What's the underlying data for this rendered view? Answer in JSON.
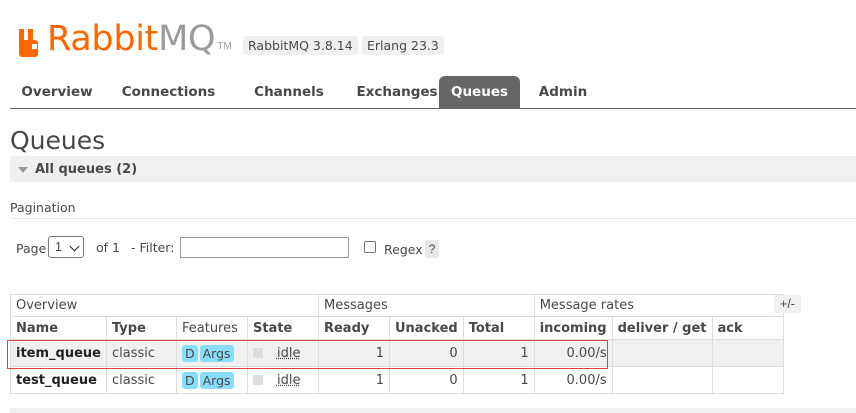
{
  "header": {
    "logo_rabbit": "Rabbit",
    "logo_mq": "MQ",
    "logo_tm": "TM",
    "rabbitmq_version": "RabbitMQ 3.8.14",
    "erlang_version": "Erlang 23.3",
    "brand_color": "#ff6600"
  },
  "nav": {
    "tabs": [
      {
        "label": "Overview"
      },
      {
        "label": "Connections"
      },
      {
        "label": "Channels"
      },
      {
        "label": "Exchanges"
      },
      {
        "label": "Queues",
        "active": true
      },
      {
        "label": "Admin"
      }
    ]
  },
  "page": {
    "title": "Queues",
    "section_label": "All queues (2)"
  },
  "pagination": {
    "heading": "Pagination",
    "page_label": "Page",
    "page_value": "1",
    "of_label": "of 1",
    "filter_label": "- Filter:",
    "filter_value": "",
    "regex_label": "Regex",
    "help_label": "?"
  },
  "table": {
    "groups": {
      "overview": "Overview",
      "messages": "Messages",
      "message_rates": "Message rates"
    },
    "plus_minus": "+/-",
    "columns": [
      "Name",
      "Type",
      "Features",
      "State",
      "Ready",
      "Unacked",
      "Total",
      "incoming",
      "deliver / get",
      "ack"
    ],
    "rows": [
      {
        "name": "item_queue",
        "type": "classic",
        "feature_d": "D",
        "feature_args": "Args",
        "state": "idle",
        "ready": "1",
        "unacked": "0",
        "total": "1",
        "incoming": "0.00/s",
        "deliver_get": "",
        "ack": ""
      },
      {
        "name": "test_queue",
        "type": "classic",
        "feature_d": "D",
        "feature_args": "Args",
        "state": "idle",
        "ready": "1",
        "unacked": "0",
        "total": "1",
        "incoming": "0.00/s",
        "deliver_get": "",
        "ack": ""
      }
    ]
  }
}
